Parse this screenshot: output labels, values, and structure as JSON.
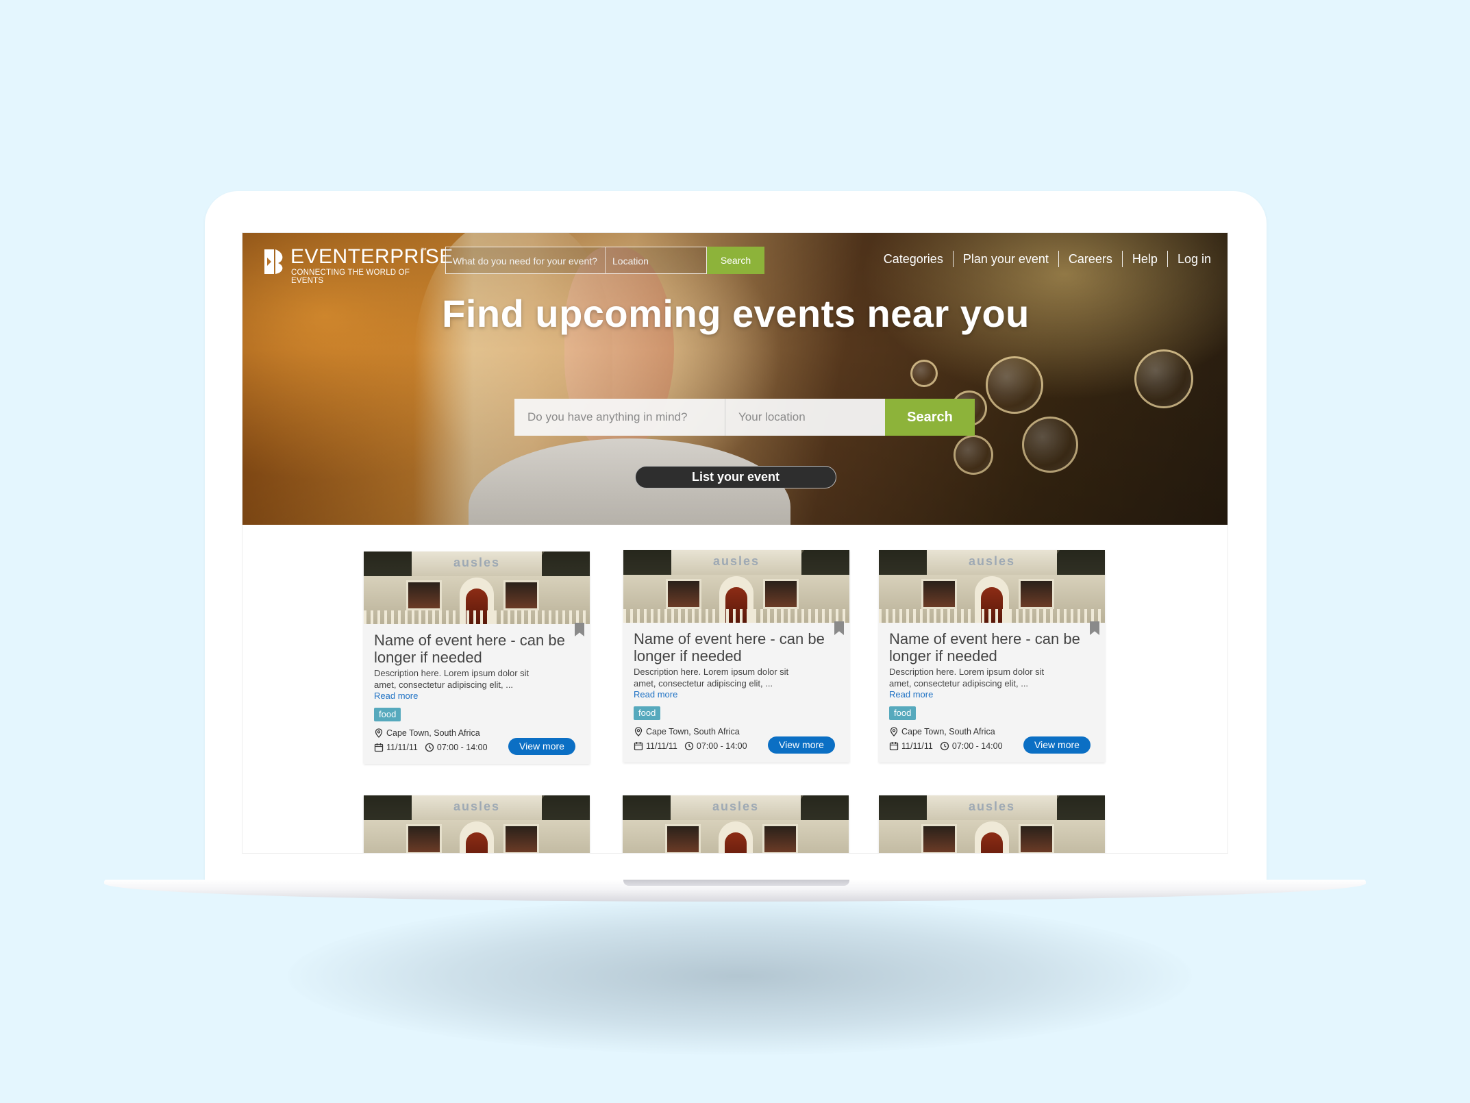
{
  "header": {
    "logo_name": "EVENTERPRISE",
    "logo_tm": "™",
    "logo_tagline": "CONNECTING THE WORLD OF EVENTS",
    "search_placeholder": "What do you need for your event?",
    "location_placeholder": "Location",
    "search_label": "Search",
    "nav": [
      "Categories",
      "Plan your event",
      "Careers",
      "Help",
      "Log in"
    ]
  },
  "hero": {
    "title": "Find upcoming events near you",
    "search_placeholder": "Do you have anything in mind?",
    "location_placeholder": "Your location",
    "search_label": "Search",
    "list_label": "List your event"
  },
  "cards": [
    {
      "image_text": "ausles",
      "title": "Name of event here - can be longer if needed",
      "description": "Description here. Lorem ipsum dolor sit amet, consectetur adipiscing elit, ...",
      "read_more": "Read more",
      "tag": "food",
      "location": "Cape Town, South Africa",
      "date": "11/11/11",
      "time": "07:00 - 14:00",
      "view_label": "View more"
    },
    {
      "image_text": "ausles",
      "title": "Name of event here - can be longer if needed",
      "description": "Description here. Lorem ipsum dolor sit amet, consectetur adipiscing elit, ...",
      "read_more": "Read more",
      "tag": "food",
      "location": "Cape Town, South Africa",
      "date": "11/11/11",
      "time": "07:00 - 14:00",
      "view_label": "View more"
    },
    {
      "image_text": "ausles",
      "title": "Name of event here - can be longer if needed",
      "description": "Description here. Lorem ipsum dolor sit amet, consectetur adipiscing elit, ...",
      "read_more": "Read more",
      "tag": "food",
      "location": "Cape Town, South Africa",
      "date": "11/11/11",
      "time": "07:00 - 14:00",
      "view_label": "View more"
    },
    {
      "image_text": "ausles"
    },
    {
      "image_text": "ausles"
    },
    {
      "image_text": "ausles"
    }
  ],
  "colors": {
    "background": "#e4f6fe",
    "accent_green": "#8db33a",
    "primary_blue": "#0b6fc4",
    "tag_teal": "#56a9bd",
    "link_blue": "#1f72c4"
  },
  "icons": {
    "logo": "eventerprise-logo-icon",
    "bookmark": "bookmark-icon",
    "location": "map-pin-icon",
    "date": "calendar-icon",
    "time": "clock-icon"
  }
}
